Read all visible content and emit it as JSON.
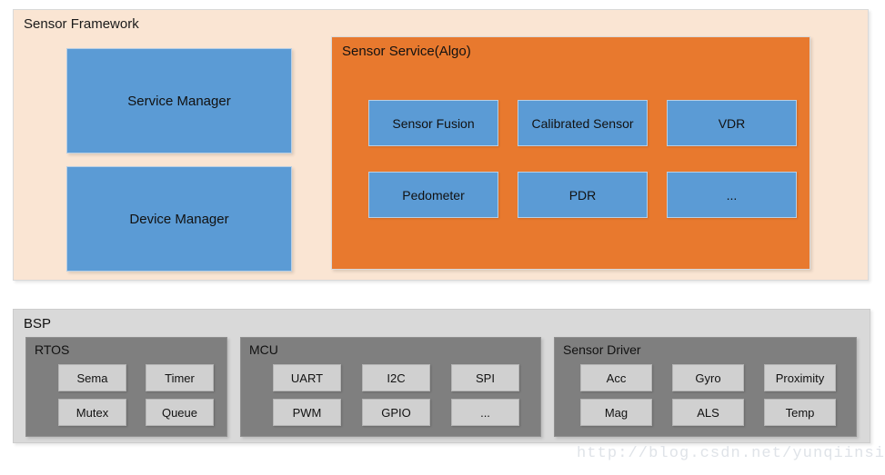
{
  "framework": {
    "title": "Sensor Framework",
    "managers": [
      {
        "label": "Service Manager"
      },
      {
        "label": "Device Manager"
      }
    ],
    "sensor_service": {
      "title": "Sensor Service(Algo)",
      "modules_row1": [
        {
          "label": "Sensor Fusion"
        },
        {
          "label": "Calibrated Sensor"
        },
        {
          "label": "VDR"
        }
      ],
      "modules_row2": [
        {
          "label": "Pedometer"
        },
        {
          "label": "PDR"
        },
        {
          "label": "..."
        }
      ]
    }
  },
  "bsp": {
    "title": "BSP",
    "groups": [
      {
        "title": "RTOS",
        "row1": [
          {
            "label": "Sema"
          },
          {
            "label": "Timer"
          }
        ],
        "row2": [
          {
            "label": "Mutex"
          },
          {
            "label": "Queue"
          }
        ]
      },
      {
        "title": "MCU",
        "row1": [
          {
            "label": "UART"
          },
          {
            "label": "I2C"
          },
          {
            "label": "SPI"
          }
        ],
        "row2": [
          {
            "label": "PWM"
          },
          {
            "label": "GPIO"
          },
          {
            "label": "..."
          }
        ]
      },
      {
        "title": "Sensor Driver",
        "row1": [
          {
            "label": "Acc"
          },
          {
            "label": "Gyro"
          },
          {
            "label": "Proximity"
          }
        ],
        "row2": [
          {
            "label": "Mag"
          },
          {
            "label": "ALS"
          },
          {
            "label": "Temp"
          }
        ]
      }
    ]
  },
  "watermark": {
    "text": "http://blog.csdn.net/yunqiinsight"
  },
  "colors": {
    "framework_bg": "#FAE5D3",
    "service_bg": "#E8792E",
    "block_blue": "#5B9BD5",
    "bsp_bg": "#D9D9D9",
    "group_gray": "#7F7F7F",
    "leaf_gray": "#D0D0D0"
  }
}
